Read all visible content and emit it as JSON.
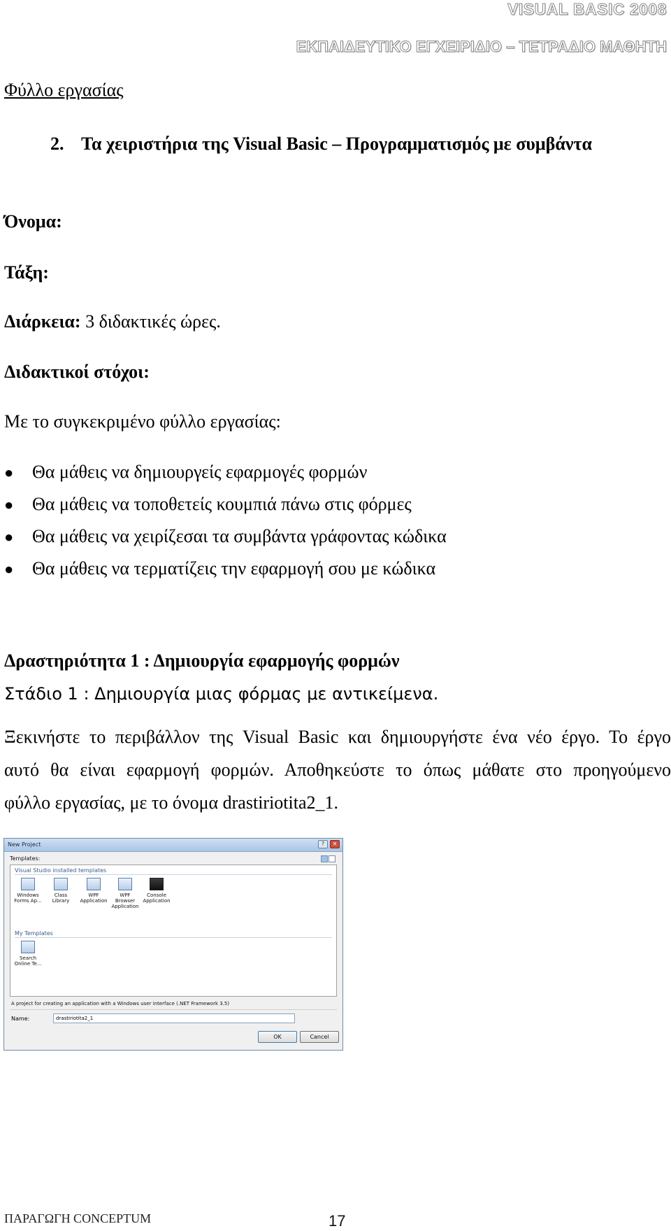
{
  "header": {
    "line1": "VISUAL BASIC 2008",
    "line2": "ΕΚΠΑΙΔΕΥΤΙΚΟ ΕΓΧΕΙΡΙΔΙΟ – ΤΕΤΡΑΔΙΟ ΜΑΘΗΤΗ"
  },
  "worksheet_label": "Φύλλο εργασίας",
  "title": {
    "number": "2.",
    "text": "Τα χειριστήρια της Visual Basic – Προγραμματισμός με συμβάντα"
  },
  "fields": {
    "name_label": "Όνομα:",
    "class_label": "Τάξη:",
    "duration_label": "Διάρκεια:",
    "duration_value": " 3 διδακτικές ώρες."
  },
  "objectives": {
    "heading": "Διδακτικοί στόχοι:",
    "intro": "Με το συγκεκριμένο φύλλο εργασίας:",
    "items": [
      "Θα μάθεις να δημιουργείς εφαρμογές φορμών",
      "Θα μάθεις να τοποθετείς κουμπιά πάνω στις φόρμες",
      "Θα μάθεις να χειρίζεσαι τα συμβάντα γράφοντας κώδικα",
      "Θα μάθεις να τερματίζεις την εφαρμογή σου με κώδικα"
    ]
  },
  "activity": {
    "heading": "Δραστηριότητα 1 : Δημιουργία εφαρμογής φορμών",
    "stage": "Στάδιο 1 : Δημιουργία μιας φόρμας με αντικείμενα.",
    "paragraph_lines": [
      "Ξεκινήστε το περιβάλλον της Visual Basic και δημιουργήστε ένα νέο έργο. Το έργο",
      "αυτό θα είναι εφαρμογή φορμών. Αποθηκεύστε το όπως μάθατε στο προηγούμενο",
      "φύλλο εργασίας, με το όνομα drastiriotita2_1."
    ]
  },
  "dialog": {
    "title": "New Project",
    "help_glyph": "?",
    "close_glyph": "✕",
    "templates_label": "Templates:",
    "installed_group": "Visual Studio installed templates",
    "installed_templates": [
      {
        "line1": "Windows",
        "line2": "Forms Ap..."
      },
      {
        "line1": "Class Library",
        "line2": ""
      },
      {
        "line1": "WPF",
        "line2": "Application"
      },
      {
        "line1": "WPF Browser",
        "line2": "Application"
      },
      {
        "line1": "Console",
        "line2": "Application"
      }
    ],
    "my_group": "My Templates",
    "my_templates": [
      {
        "line1": "Search",
        "line2": "Online Te..."
      }
    ],
    "description": "A project for creating an application with a Windows user interface (.NET Framework 3.5)",
    "name_label": "Name:",
    "name_value": "drastiriotita2_1",
    "ok_label": "OK",
    "cancel_label": "Cancel"
  },
  "footer": {
    "producer": "ΠΑΡΑΓΩΓΗ CONCEPTUM",
    "page_number": "17"
  }
}
